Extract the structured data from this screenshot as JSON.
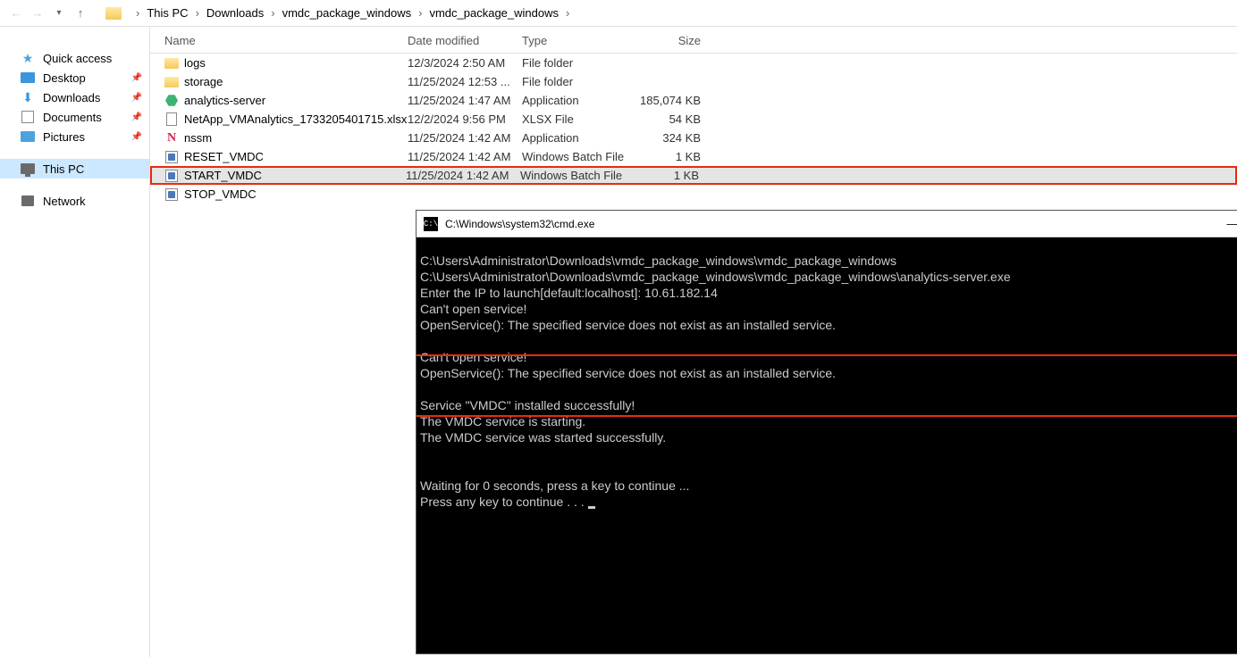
{
  "breadcrumb": {
    "items": [
      "This PC",
      "Downloads",
      "vmdc_package_windows",
      "vmdc_package_windows"
    ]
  },
  "sidebar": {
    "quick_access": "Quick access",
    "desktop": "Desktop",
    "downloads": "Downloads",
    "documents": "Documents",
    "pictures": "Pictures",
    "this_pc": "This PC",
    "network": "Network"
  },
  "columns": {
    "name": "Name",
    "date": "Date modified",
    "type": "Type",
    "size": "Size"
  },
  "files": [
    {
      "name": "logs",
      "date": "12/3/2024 2:50 AM",
      "type": "File folder",
      "size": "",
      "icon": "folder"
    },
    {
      "name": "storage",
      "date": "11/25/2024 12:53 ...",
      "type": "File folder",
      "size": "",
      "icon": "folder"
    },
    {
      "name": "analytics-server",
      "date": "11/25/2024 1:47 AM",
      "type": "Application",
      "size": "185,074 KB",
      "icon": "hex"
    },
    {
      "name": "NetApp_VMAnalytics_1733205401715.xlsx",
      "date": "12/2/2024 9:56 PM",
      "type": "XLSX File",
      "size": "54 KB",
      "icon": "doc"
    },
    {
      "name": "nssm",
      "date": "11/25/2024 1:42 AM",
      "type": "Application",
      "size": "324 KB",
      "icon": "n"
    },
    {
      "name": "RESET_VMDC",
      "date": "11/25/2024 1:42 AM",
      "type": "Windows Batch File",
      "size": "1 KB",
      "icon": "batch"
    },
    {
      "name": "START_VMDC",
      "date": "11/25/2024 1:42 AM",
      "type": "Windows Batch File",
      "size": "1 KB",
      "icon": "batch",
      "highlight": true
    },
    {
      "name": "STOP_VMDC",
      "date": "",
      "type": "",
      "size": "",
      "icon": "batch"
    }
  ],
  "cmd": {
    "title": "C:\\Windows\\system32\\cmd.exe",
    "lines": {
      "l1": "C:\\Users\\Administrator\\Downloads\\vmdc_package_windows\\vmdc_package_windows",
      "l2": "C:\\Users\\Administrator\\Downloads\\vmdc_package_windows\\vmdc_package_windows\\analytics-server.exe",
      "l3": "Enter the IP to launch[default:localhost]: 10.61.182.14",
      "l4": "Can't open service!",
      "l5": "OpenService(): The specified service does not exist as an installed service.",
      "l6": "",
      "l7": "Can't open service!",
      "l8": "OpenService(): The specified service does not exist as an installed service.",
      "l9": "",
      "h1": "Service \"VMDC\" installed successfully!",
      "h2": "The VMDC service is starting.",
      "h3": "The VMDC service was started successfully.",
      "l10": "",
      "l11": "",
      "l12": "Waiting for 0 seconds, press a key to continue ...",
      "l13": "Press any key to continue . . . "
    }
  }
}
